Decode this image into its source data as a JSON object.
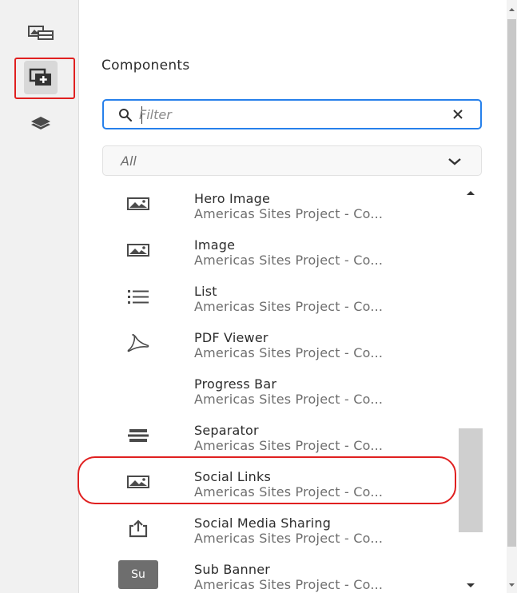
{
  "panel": {
    "title": "Components",
    "search": {
      "placeholder": "Filter",
      "value": ""
    },
    "group_filter": {
      "selected": "All"
    }
  },
  "rail": {
    "items": [
      {
        "icon": "assets-icon",
        "active": false
      },
      {
        "icon": "components-icon",
        "active": true
      },
      {
        "icon": "layers-icon",
        "active": false
      }
    ]
  },
  "components": [
    {
      "name": "Hero Image",
      "group": "Americas Sites Project - Co...",
      "icon": "image-icon"
    },
    {
      "name": "Image",
      "group": "Americas Sites Project - Co...",
      "icon": "image-icon"
    },
    {
      "name": "List",
      "group": "Americas Sites Project - Co...",
      "icon": "list-icon"
    },
    {
      "name": "PDF Viewer",
      "group": "Americas Sites Project - Co...",
      "icon": "pdf-icon"
    },
    {
      "name": "Progress Bar",
      "group": "Americas Sites Project - Co...",
      "icon": ""
    },
    {
      "name": "Separator",
      "group": "Americas Sites Project - Co...",
      "icon": "separator-icon"
    },
    {
      "name": "Social Links",
      "group": "Americas Sites Project - Co...",
      "icon": "image-icon"
    },
    {
      "name": "Social Media Sharing",
      "group": "Americas Sites Project - Co...",
      "icon": "share-icon"
    },
    {
      "name": "Sub Banner",
      "group": "Americas Sites Project - Co...",
      "icon": "abbr-badge",
      "badge": "Su"
    }
  ],
  "colors": {
    "accent": "#2680eb",
    "highlight": "#e02020",
    "rail_bg": "#f1f1f1"
  }
}
